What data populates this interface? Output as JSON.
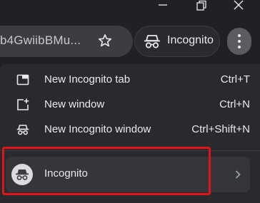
{
  "toolbar": {
    "url_text": "b4GwiibBMu...",
    "incognito_chip_label": "Incognito"
  },
  "menu": {
    "items": [
      {
        "label": "New Incognito tab",
        "shortcut": "Ctrl+T",
        "icon": "new-tab-icon"
      },
      {
        "label": "New window",
        "shortcut": "Ctrl+N",
        "icon": "new-window-icon"
      },
      {
        "label": "New Incognito window",
        "shortcut": "Ctrl+Shift+N",
        "icon": "incognito-icon"
      }
    ],
    "profile": {
      "label": "Incognito",
      "icon": "incognito-avatar-icon"
    }
  },
  "colors": {
    "background": "#202124",
    "menu_bg": "#292a2d",
    "highlight": "#e0151b"
  }
}
